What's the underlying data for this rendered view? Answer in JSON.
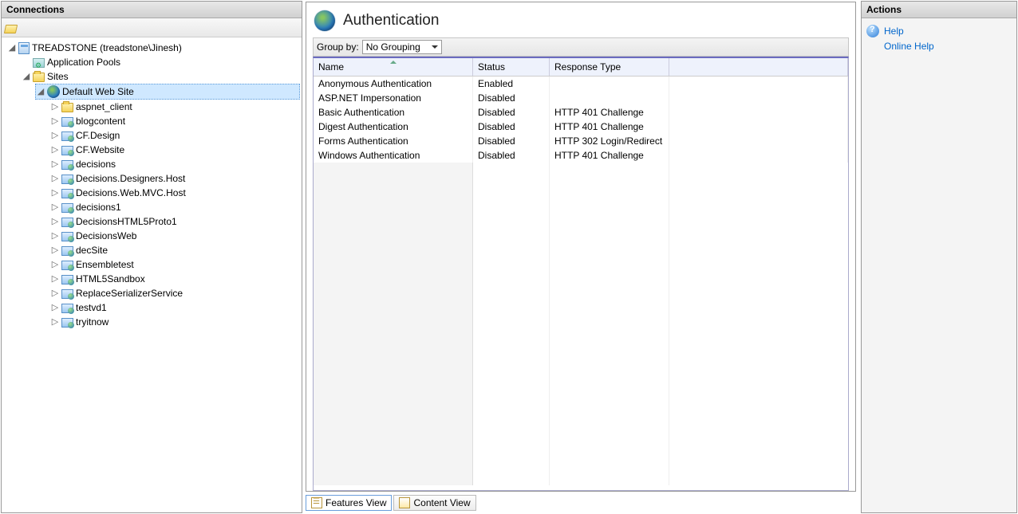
{
  "left": {
    "title": "Connections",
    "server": "TREADSTONE (treadstone\\Jinesh)",
    "appPools": "Application Pools",
    "sitesLabel": "Sites",
    "defaultSite": "Default Web Site",
    "children": [
      {
        "label": "aspnet_client",
        "icon": "folder"
      },
      {
        "label": "blogcontent",
        "icon": "site"
      },
      {
        "label": "CF.Design",
        "icon": "site"
      },
      {
        "label": "CF.Website",
        "icon": "site"
      },
      {
        "label": "decisions",
        "icon": "site"
      },
      {
        "label": "Decisions.Designers.Host",
        "icon": "site"
      },
      {
        "label": "Decisions.Web.MVC.Host",
        "icon": "site"
      },
      {
        "label": "decisions1",
        "icon": "site"
      },
      {
        "label": "DecisionsHTML5Proto1",
        "icon": "site"
      },
      {
        "label": "DecisionsWeb",
        "icon": "site"
      },
      {
        "label": "decSite",
        "icon": "site"
      },
      {
        "label": "Ensembletest",
        "icon": "site"
      },
      {
        "label": "HTML5Sandbox",
        "icon": "site"
      },
      {
        "label": "ReplaceSerializerService",
        "icon": "site"
      },
      {
        "label": "testvd1",
        "icon": "site"
      },
      {
        "label": "tryitnow",
        "icon": "site"
      }
    ]
  },
  "main": {
    "title": "Authentication",
    "groupByLabel": "Group by:",
    "groupByValue": "No Grouping",
    "columns": {
      "name": "Name",
      "status": "Status",
      "resp": "Response Type"
    },
    "rows": [
      {
        "name": "Anonymous Authentication",
        "status": "Enabled",
        "resp": ""
      },
      {
        "name": "ASP.NET Impersonation",
        "status": "Disabled",
        "resp": ""
      },
      {
        "name": "Basic Authentication",
        "status": "Disabled",
        "resp": "HTTP 401 Challenge"
      },
      {
        "name": "Digest Authentication",
        "status": "Disabled",
        "resp": "HTTP 401 Challenge"
      },
      {
        "name": "Forms Authentication",
        "status": "Disabled",
        "resp": "HTTP 302 Login/Redirect"
      },
      {
        "name": "Windows Authentication",
        "status": "Disabled",
        "resp": "HTTP 401 Challenge"
      }
    ],
    "featuresView": "Features View",
    "contentView": "Content View"
  },
  "right": {
    "title": "Actions",
    "help": "Help",
    "onlineHelp": "Online Help"
  }
}
